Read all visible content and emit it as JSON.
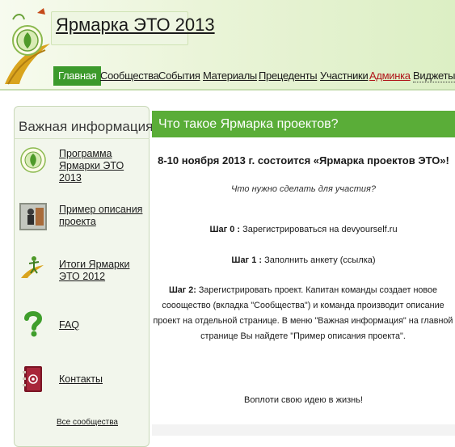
{
  "colors": {
    "accent_green": "#5aad38",
    "nav_active": "#3c9a2c",
    "nav_red": "#b0161a"
  },
  "site": {
    "title": "Ярмарка ЭТО 2013",
    "logo_icon": "eco-logo-icon"
  },
  "nav": {
    "items": [
      {
        "label": "Главная",
        "active": true
      },
      {
        "label": "Сообщества"
      },
      {
        "label": "События"
      },
      {
        "label": "Материалы"
      },
      {
        "label": "Прецеденты"
      },
      {
        "label": "Участники"
      },
      {
        "label": "Админка",
        "color": "red"
      },
      {
        "label": "Виджеты"
      }
    ]
  },
  "sidebar": {
    "heading": "Важная информация",
    "items": [
      {
        "label": "Программа Ярмарки ЭТО 2013",
        "icon": "eco-logo-icon"
      },
      {
        "label": "Пример описания проекта",
        "icon": "person-photo-icon"
      },
      {
        "label": "Итоги Ярмарки ЭТО 2012",
        "icon": "figure-icon"
      },
      {
        "label": "FAQ",
        "icon": "question-icon"
      },
      {
        "label": "Контакты",
        "icon": "address-book-icon"
      }
    ],
    "footer_link": "Все сообщества"
  },
  "main": {
    "title": "Что такое Ярмарка проектов?",
    "headline": "8-10 ноября 2013 г. состоится «Ярмарка проектов ЭТО»!",
    "subtitle": "Что нужно сделать для участия?",
    "step0_label": "Шаг 0 :",
    "step0_text": "Зарегистрироваться на devyourself.ru",
    "step1_label": "Шаг 1 :",
    "step1_text": "Заполнить анкету (ссылка)",
    "step2_label": "Шаг 2:",
    "step2_text": "Зарегистрировать проект. Капитан команды создает новое сооощество (вкладка \"Сообщества\") и команда производит описание проект на отдельной странице. В меню \"Важная информация\" на главной странице Вы найдете \"Пример описания проекта\".",
    "closing": "Воплоти свою идею в жизнь!"
  }
}
